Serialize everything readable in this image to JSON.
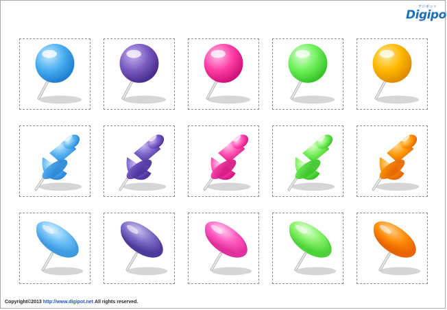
{
  "logo": {
    "text": "Digipot",
    "kana": "デジポット"
  },
  "footer": {
    "copyright": "Copyright©2013",
    "url": "http://www.digipot.net",
    "rights": "All rights reserved."
  },
  "rows": [
    {
      "type": "ball-pin",
      "items": [
        {
          "name": "blue",
          "color": "#4aaef0",
          "light": "#c7ebff",
          "dark": "#1f7fd1"
        },
        {
          "name": "purple",
          "color": "#7a5ac0",
          "light": "#c8b4ef",
          "dark": "#4a2d8d"
        },
        {
          "name": "pink",
          "color": "#ff3fa6",
          "light": "#ffc0e6",
          "dark": "#d0127b"
        },
        {
          "name": "green",
          "color": "#6ef05a",
          "light": "#dcffd2",
          "dark": "#38c52a"
        },
        {
          "name": "yellow",
          "color": "#ffb800",
          "light": "#ffe89a",
          "dark": "#e08d00"
        }
      ]
    },
    {
      "type": "push-pin",
      "items": [
        {
          "name": "blue",
          "color": "#5ab4f2",
          "light": "#cfeeff",
          "dark": "#2c8ad8"
        },
        {
          "name": "purple",
          "color": "#7c62c8",
          "light": "#c9b9f2",
          "dark": "#4e35a0"
        },
        {
          "name": "pink",
          "color": "#ff4eb2",
          "light": "#ffc8ec",
          "dark": "#d81c86"
        },
        {
          "name": "green",
          "color": "#79f05e",
          "light": "#ddffd0",
          "dark": "#3ec72c"
        },
        {
          "name": "orange",
          "color": "#ff9a0a",
          "light": "#ffd892",
          "dark": "#e86a00"
        }
      ]
    },
    {
      "type": "flat-tack",
      "items": [
        {
          "name": "blue",
          "color": "#6ec0f6",
          "light": "#d6f0ff",
          "dark": "#3f9be0"
        },
        {
          "name": "purple",
          "color": "#7e6ac4",
          "light": "#cdc0f0",
          "dark": "#4e3a9c"
        },
        {
          "name": "pink",
          "color": "#ff5ac0",
          "light": "#ffd0ef",
          "dark": "#e0309c"
        },
        {
          "name": "green",
          "color": "#84f066",
          "light": "#e0ffd4",
          "dark": "#4ed23a"
        },
        {
          "name": "orange",
          "color": "#ff8c0a",
          "light": "#ffd08a",
          "dark": "#e86400"
        }
      ]
    }
  ]
}
